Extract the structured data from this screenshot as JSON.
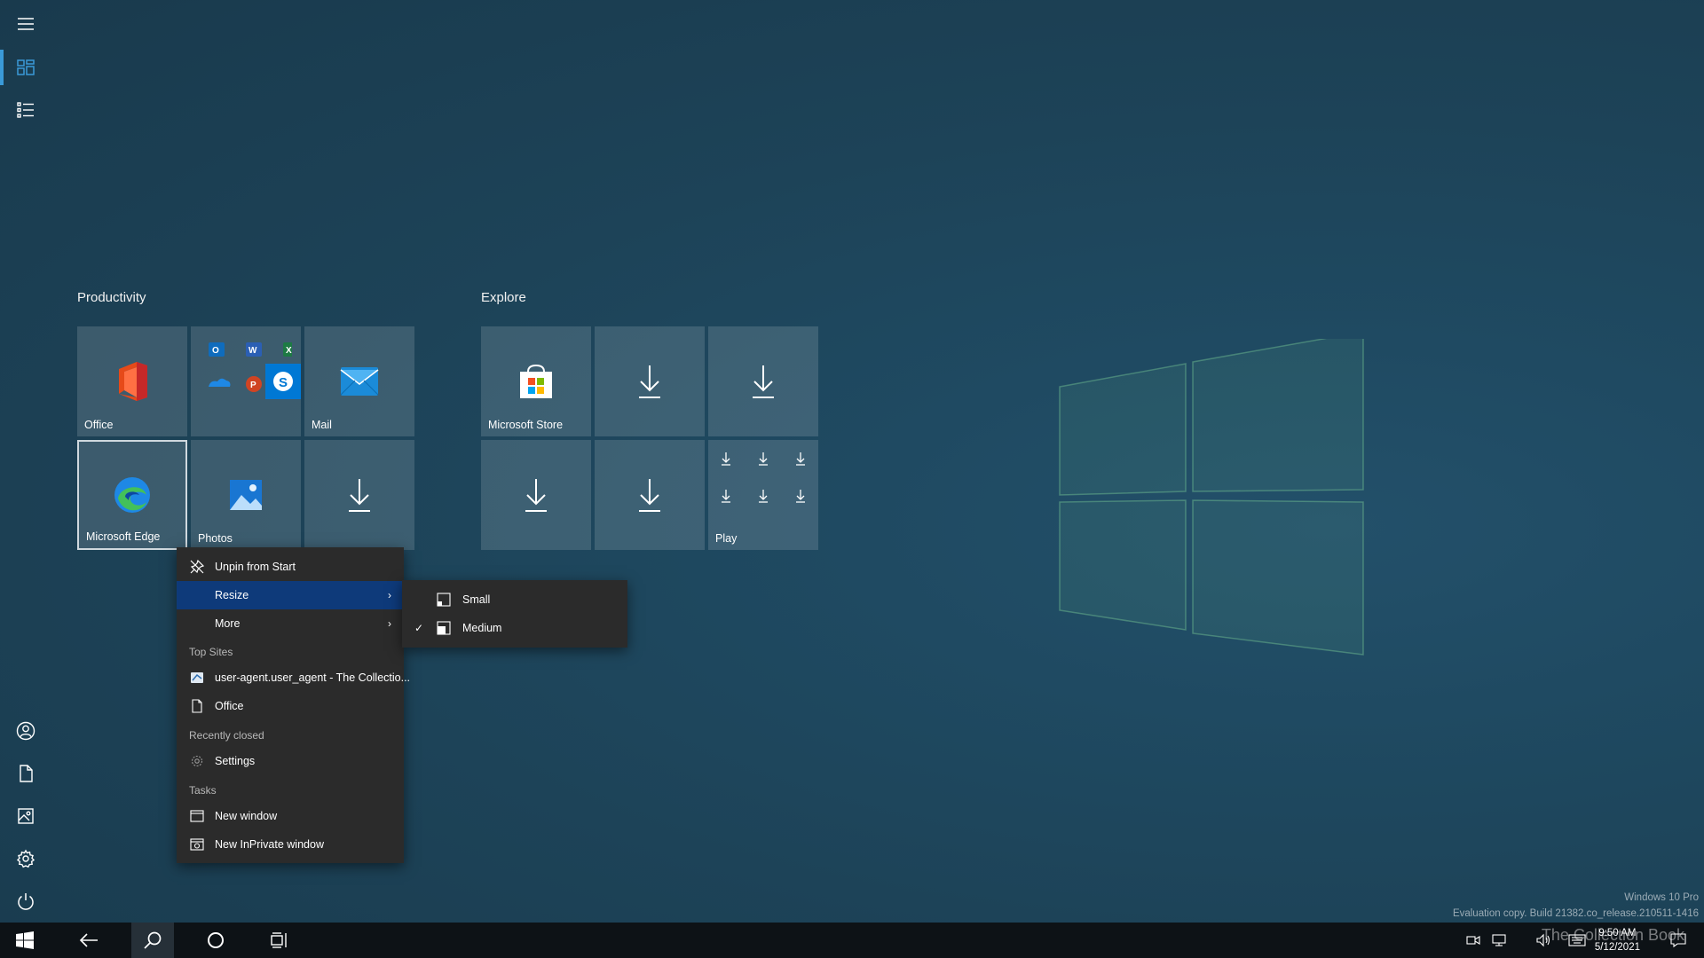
{
  "start": {
    "groups": [
      {
        "title": "Productivity"
      },
      {
        "title": "Explore"
      }
    ],
    "tiles": {
      "office": "Office",
      "mail": "Mail",
      "edge": "Microsoft Edge",
      "photos": "Photos",
      "store": "Microsoft Store",
      "play": "Play"
    }
  },
  "context_menu": {
    "unpin": "Unpin from Start",
    "resize": "Resize",
    "more": "More",
    "top_sites_header": "Top Sites",
    "top_site_1": "user-agent.user_agent - The Collectio...",
    "top_site_2": "Office",
    "recently_closed_header": "Recently closed",
    "recent_1": "Settings",
    "tasks_header": "Tasks",
    "task_1": "New window",
    "task_2": "New InPrivate window"
  },
  "resize_submenu": {
    "small": "Small",
    "medium": "Medium",
    "selected": "Medium"
  },
  "watermark": {
    "line1": "Windows 10 Pro",
    "line2": "Evaluation copy. Build 21382.co_release.210511-1416",
    "brand": "The Collection Book"
  },
  "clock": {
    "time": "9:50 AM",
    "date": "5/12/2021"
  },
  "colors": {
    "accent": "#3a9ad8",
    "menu_highlight": "#0e3a7a",
    "menu_bg": "#2b2b2b",
    "taskbar": "#0d1216"
  }
}
